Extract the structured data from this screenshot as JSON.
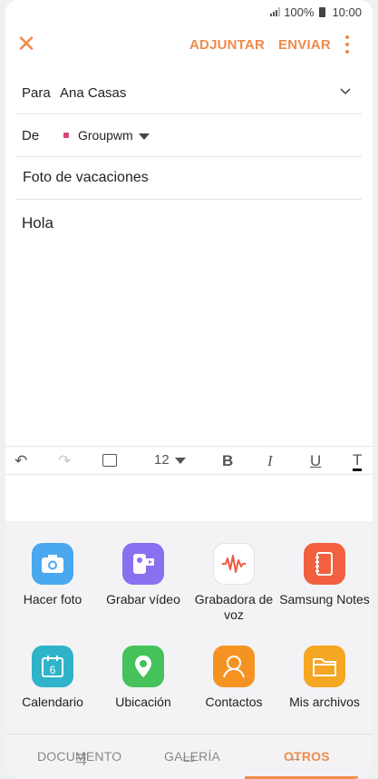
{
  "status_bar": {
    "battery": "100%",
    "time": "10:00"
  },
  "toolbar": {
    "attach_label": "ADJUNTAR",
    "send_label": "ENVIAR"
  },
  "compose": {
    "to_label": "Para",
    "to_value": "Ana Casas",
    "from_label": "De",
    "from_value": "Groupwm",
    "subject": "Foto de vacaciones",
    "body": "Hola"
  },
  "format_bar": {
    "font_size": "12",
    "bold": "B",
    "italic": "I",
    "underline": "U",
    "text_color": "T"
  },
  "attachments": [
    {
      "label": "Hacer foto",
      "icon": "camera-icon",
      "color": "#4aa8f0"
    },
    {
      "label": "Grabar vídeo",
      "icon": "video-record-icon",
      "color": "#8a6ff0"
    },
    {
      "label": "Grabadora de voz",
      "icon": "voice-recorder-icon",
      "color": "#ffffff"
    },
    {
      "label": "Samsung Notes",
      "icon": "notes-icon",
      "color": "#f2603f"
    },
    {
      "label": "Calendario",
      "icon": "calendar-icon",
      "color": "#2fb3c9"
    },
    {
      "label": "Ubicación",
      "icon": "location-pin-icon",
      "color": "#45c25a"
    },
    {
      "label": "Contactos",
      "icon": "contacts-icon",
      "color": "#f59322"
    },
    {
      "label": "Mis archivos",
      "icon": "folder-icon",
      "color": "#f5a623"
    }
  ],
  "calendar_day": "6",
  "tabs": {
    "documento": "DOCUMENTO",
    "galeria": "GALERÍA",
    "otros": "OTROS"
  },
  "colors": {
    "accent": "#f08a4b"
  }
}
